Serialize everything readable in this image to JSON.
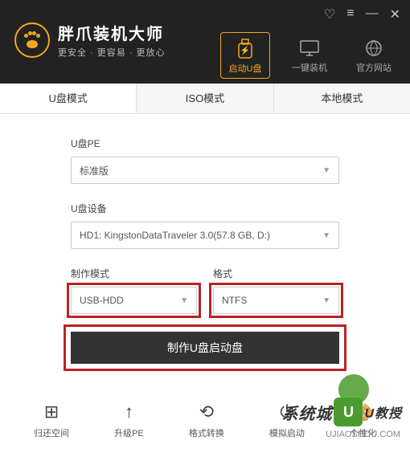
{
  "brand": {
    "title": "胖爪装机大师",
    "subtitle": "更安全 · 更容易 · 更放心"
  },
  "titlebar": {
    "headset": "headset-icon",
    "menu": "menu-icon",
    "min": "minimize-icon",
    "close": "close-icon"
  },
  "topnav": {
    "items": [
      {
        "id": "boot-usb",
        "label": "启动U盘",
        "active": true
      },
      {
        "id": "one-click",
        "label": "一键装机",
        "active": false
      },
      {
        "id": "official-site",
        "label": "官方网站",
        "active": false
      }
    ]
  },
  "tabs": {
    "items": [
      {
        "id": "usb-mode",
        "label": "U盘模式",
        "active": true
      },
      {
        "id": "iso-mode",
        "label": "ISO模式",
        "active": false
      },
      {
        "id": "local-mode",
        "label": "本地模式",
        "active": false
      }
    ]
  },
  "form": {
    "pe_label": "U盘PE",
    "pe_value": "标准版",
    "device_label": "U盘设备",
    "device_value": "HD1: KingstonDataTraveler 3.0(57.8 GB, D:)",
    "make_mode_label": "制作模式",
    "make_mode_value": "USB-HDD",
    "format_label": "格式",
    "format_value": "NTFS",
    "make_button": "制作U盘启动盘"
  },
  "bottom": {
    "items": [
      {
        "id": "restore",
        "label": "归还空间"
      },
      {
        "id": "upgrade",
        "label": "升级PE"
      },
      {
        "id": "convert",
        "label": "格式转换"
      },
      {
        "id": "simulate",
        "label": "模拟启动"
      },
      {
        "id": "customize",
        "label": "个性化"
      }
    ]
  },
  "watermark": {
    "brand": "系统城",
    "sub": "U教授",
    "url": "UJIAOSHOU.COM"
  }
}
